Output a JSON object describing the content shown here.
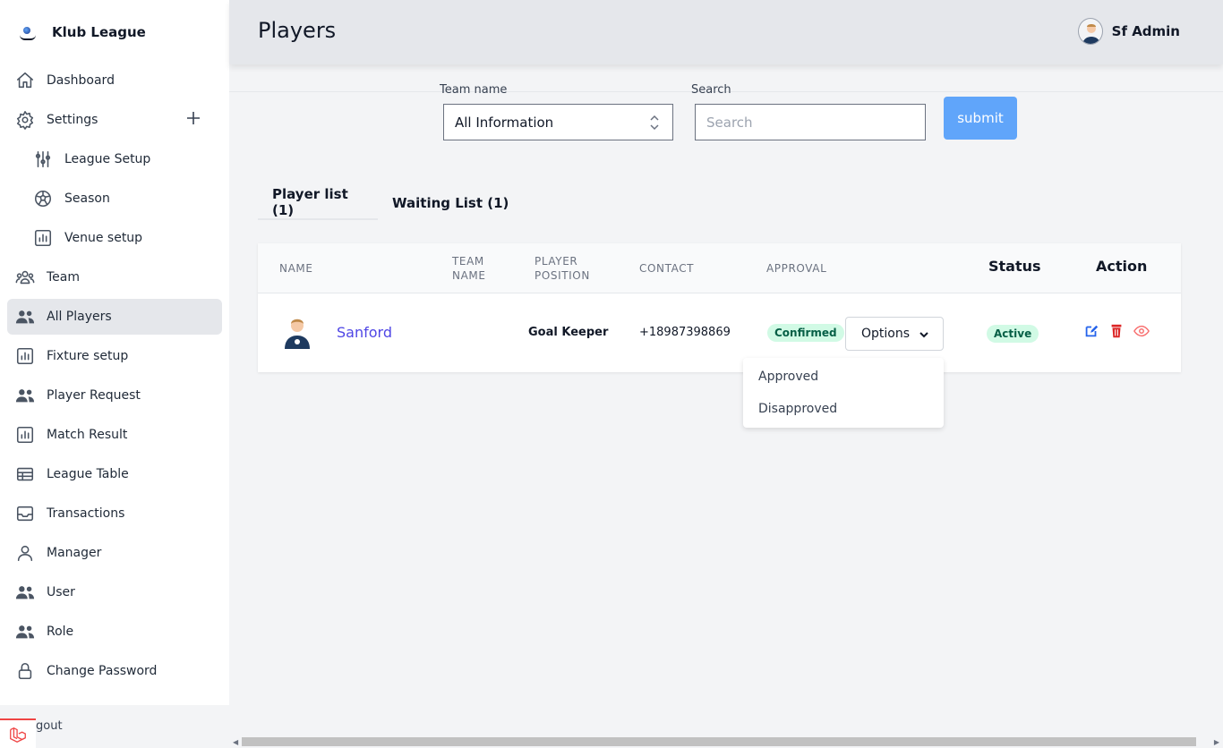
{
  "brand": {
    "name": "Klub League"
  },
  "header": {
    "title": "Players",
    "user_name": "Sf Admin"
  },
  "sidebar": {
    "items": [
      {
        "label": "Dashboard",
        "icon": "home-icon"
      },
      {
        "label": "Settings",
        "icon": "gear-icon"
      },
      {
        "label": "League Setup",
        "icon": "sliders-icon"
      },
      {
        "label": "Season",
        "icon": "soccer-ball-icon"
      },
      {
        "label": "Venue setup",
        "icon": "chart-icon"
      },
      {
        "label": "Team",
        "icon": "team-icon"
      },
      {
        "label": "All Players",
        "icon": "users-icon"
      },
      {
        "label": "Fixture setup",
        "icon": "chart-icon"
      },
      {
        "label": "Player Request",
        "icon": "users-icon"
      },
      {
        "label": "Match Result",
        "icon": "chart-icon"
      },
      {
        "label": "League Table",
        "icon": "table-icon"
      },
      {
        "label": "Transactions",
        "icon": "inbox-icon"
      },
      {
        "label": "Manager",
        "icon": "user-icon"
      },
      {
        "label": "User",
        "icon": "users-icon"
      },
      {
        "label": "Role",
        "icon": "users-icon"
      },
      {
        "label": "Change Password",
        "icon": "lock-icon"
      }
    ],
    "logout_label": "gout"
  },
  "filters": {
    "team_label": "Team name",
    "team_value": "All Information",
    "search_label": "Search",
    "search_placeholder": "Search",
    "submit_label": "submit"
  },
  "tabs": [
    {
      "label": "Player list (1)"
    },
    {
      "label": "Waiting List (1)"
    }
  ],
  "table": {
    "headers": {
      "name": "NAME",
      "team_name_1": "TEAM",
      "team_name_2": "NAME",
      "position_1": "PLAYER",
      "position_2": "POSITION",
      "contact": "CONTACT",
      "approval": "APPROVAL",
      "status": "Status",
      "action": "Action"
    },
    "rows": [
      {
        "name": "Sanford",
        "team_name": "",
        "position": "Goal Keeper",
        "contact": "+18987398869",
        "approval": "Confirmed",
        "options_label": "Options",
        "status": "Active"
      }
    ]
  },
  "dropdown": {
    "items": [
      "Approved",
      "Disapproved"
    ]
  },
  "colors": {
    "accent": "#60a5fa",
    "link": "#4f46e5",
    "badge_bg": "#d1fae5",
    "badge_text": "#065f46",
    "edit": "#2563eb",
    "delete": "#dc2626",
    "view": "#f87171"
  }
}
